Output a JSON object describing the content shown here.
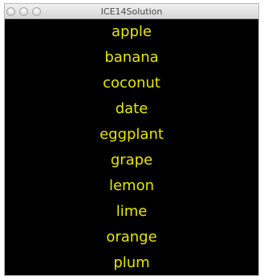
{
  "window": {
    "title": "ICE14Solution"
  },
  "colors": {
    "background": "#000000",
    "text": "#e6e600"
  },
  "fruits": [
    "apple",
    "banana",
    "coconut",
    "date",
    "eggplant",
    "grape",
    "lemon",
    "lime",
    "orange",
    "plum"
  ]
}
